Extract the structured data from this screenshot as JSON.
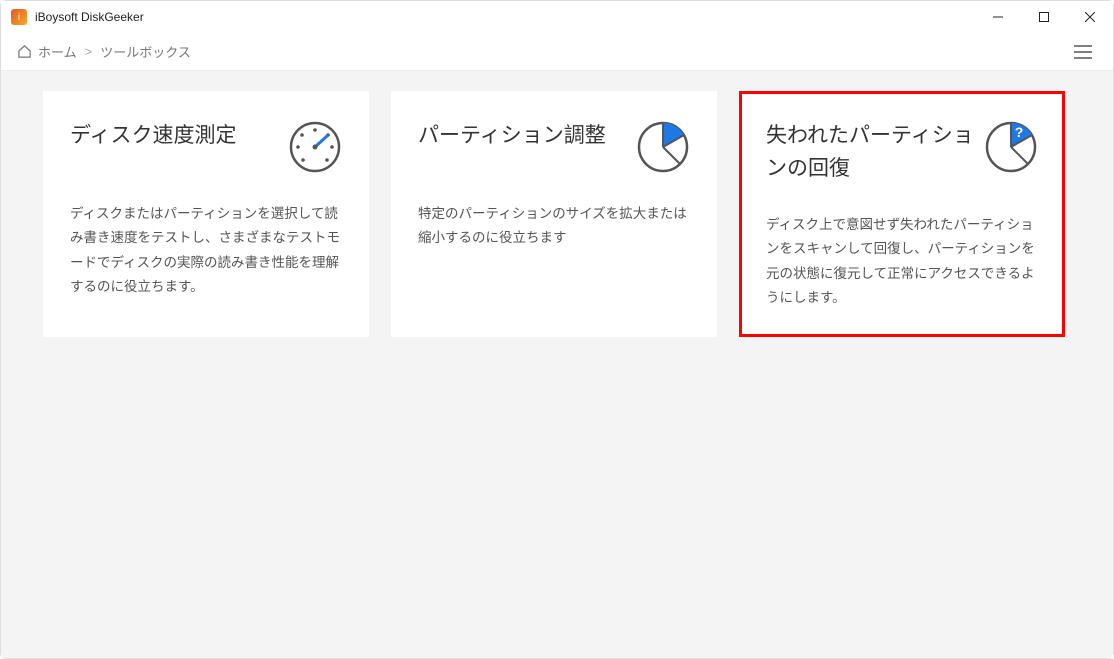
{
  "window": {
    "title": "iBoysoft DiskGeeker"
  },
  "breadcrumb": {
    "home": "ホーム",
    "sep": ">",
    "current": "ツールボックス"
  },
  "cards": [
    {
      "title": "ディスク速度測定",
      "desc": "ディスクまたはパーティションを選択して読み書き速度をテストし、さまざまなテストモードでディスクの実際の読み書き性能を理解するのに役立ちます。",
      "icon": "gauge",
      "highlight": false
    },
    {
      "title": "パーティション調整",
      "desc": "特定のパーティションのサイズを拡大または縮小するのに役立ちます",
      "icon": "pie",
      "highlight": false
    },
    {
      "title": "失われたパーティションの回復",
      "desc": "ディスク上で意図せず失われたパーティションをスキャンして回復し、パーティションを元の状態に復元して正常にアクセスできるようにします。",
      "icon": "pie-question",
      "highlight": true
    }
  ]
}
